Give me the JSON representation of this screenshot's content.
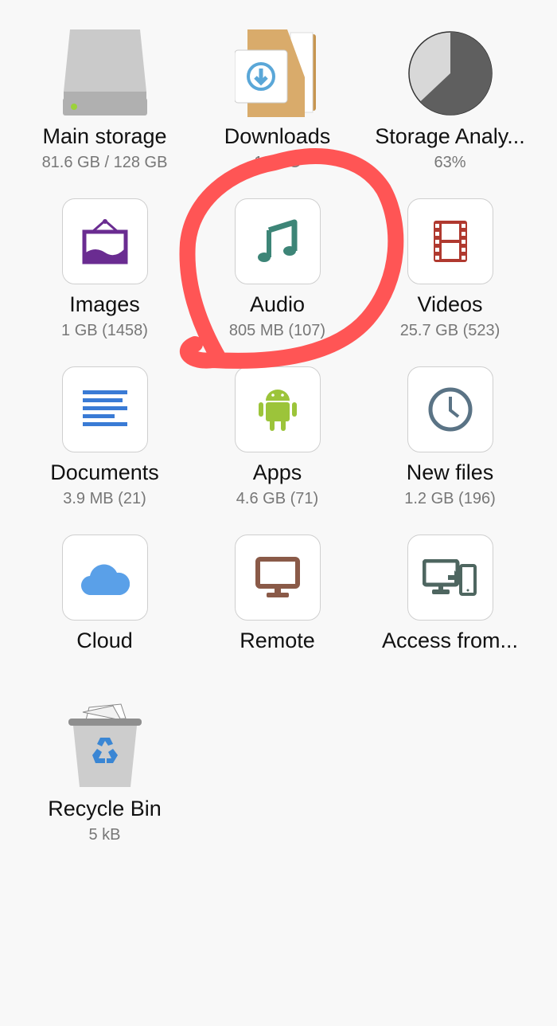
{
  "tiles": [
    {
      "label": "Main storage",
      "sub": "81.6 GB / 128 GB",
      "icon": "hard-drive-icon"
    },
    {
      "label": "Downloads",
      "sub": "11.6 G",
      "icon": "downloads-folder-icon"
    },
    {
      "label": "Storage Analy...",
      "sub": "63%",
      "icon": "pie-chart-icon",
      "percent_used": 63
    },
    {
      "label": "Images",
      "sub": "1 GB (1458)",
      "icon": "image-frame-icon"
    },
    {
      "label": "Audio",
      "sub": "805 MB (107)",
      "icon": "music-note-icon"
    },
    {
      "label": "Videos",
      "sub": "25.7 GB (523)",
      "icon": "film-strip-icon"
    },
    {
      "label": "Documents",
      "sub": "3.9 MB (21)",
      "icon": "document-lines-icon"
    },
    {
      "label": "Apps",
      "sub": "4.6 GB (71)",
      "icon": "android-icon"
    },
    {
      "label": "New files",
      "sub": "1.2 GB (196)",
      "icon": "clock-icon"
    },
    {
      "label": "Cloud",
      "sub": "",
      "icon": "cloud-icon"
    },
    {
      "label": "Remote",
      "sub": "",
      "icon": "monitor-icon"
    },
    {
      "label": "Access from...",
      "sub": "",
      "icon": "pc-to-phone-icon"
    },
    {
      "label": "Recycle Bin",
      "sub": "5 kB",
      "icon": "recycle-bin-icon"
    }
  ],
  "colors": {
    "annotation": "#ff5555",
    "audio": "#3d8577",
    "images": "#6a2c91",
    "videos": "#b0392f",
    "documents": "#3a7bd5",
    "apps": "#9cc43a",
    "clock": "#5a7385",
    "cloud": "#5aa0e8",
    "remote": "#8a5a48",
    "access": "#4e6660"
  }
}
